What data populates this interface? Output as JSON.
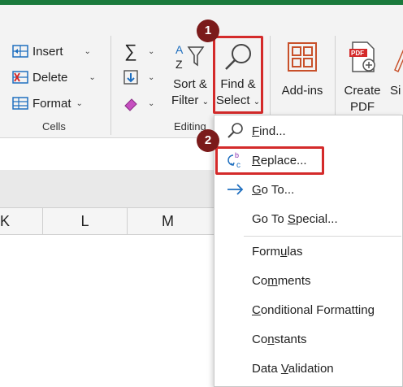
{
  "ribbon": {
    "cells": {
      "insert_label": "Insert",
      "delete_label": "Delete",
      "format_label": "Format",
      "group_label": "Cells"
    },
    "editing": {
      "sort_line1": "Sort &",
      "sort_line2": "Filter",
      "find_line1": "Find &",
      "find_line2": "Select",
      "group_label": "Editing"
    },
    "addins_label": "Add-ins",
    "create_pdf_line1": "Create",
    "create_pdf_line2": "PDF",
    "pdf_badge": "PDF",
    "cut_off_label": "Si"
  },
  "columns": [
    "K",
    "L",
    "M"
  ],
  "badges": {
    "step1": "1",
    "step2": "2"
  },
  "menu": {
    "items": [
      {
        "pre": "",
        "key": "F",
        "post": "ind...",
        "icon": "search-icon"
      },
      {
        "pre": "",
        "key": "R",
        "post": "eplace...",
        "icon": "replace-icon"
      },
      {
        "pre": "",
        "key": "G",
        "post": "o To...",
        "icon": "arrow-right-icon"
      },
      {
        "pre": "Go To ",
        "key": "S",
        "post": "pecial...",
        "icon": ""
      },
      {
        "pre": "Form",
        "key": "u",
        "post": "las",
        "icon": ""
      },
      {
        "pre": "Co",
        "key": "m",
        "post": "ments",
        "icon": ""
      },
      {
        "pre": "",
        "key": "C",
        "post": "onditional Formatting",
        "icon": ""
      },
      {
        "pre": "Co",
        "key": "n",
        "post": "stants",
        "icon": ""
      },
      {
        "pre": "Data ",
        "key": "V",
        "post": "alidation",
        "icon": ""
      }
    ]
  },
  "colors": {
    "accent_green": "#1a7a3c",
    "highlight_red": "#d42a2a",
    "badge_dark_red": "#7b1a1a",
    "icon_blue": "#1f6fbf"
  }
}
